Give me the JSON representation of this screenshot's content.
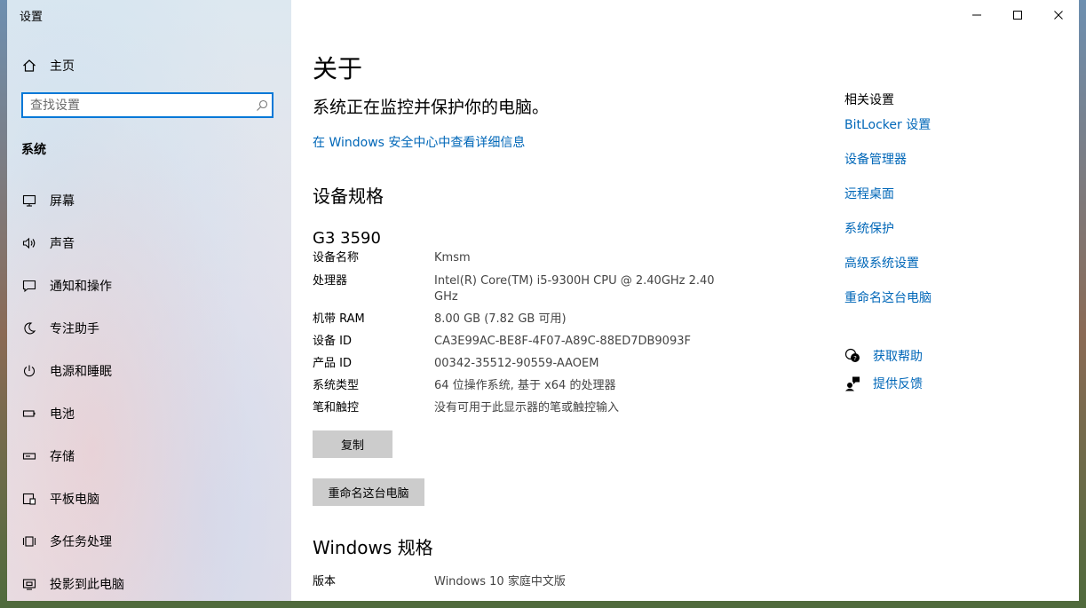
{
  "app_title": "设置",
  "sidebar": {
    "home_label": "主页",
    "search_placeholder": "查找设置",
    "section_title": "系统",
    "items": [
      {
        "label": "屏幕",
        "icon": "monitor-icon"
      },
      {
        "label": "声音",
        "icon": "speaker-icon"
      },
      {
        "label": "通知和操作",
        "icon": "notification-icon"
      },
      {
        "label": "专注助手",
        "icon": "moon-icon"
      },
      {
        "label": "电源和睡眠",
        "icon": "power-icon"
      },
      {
        "label": "电池",
        "icon": "battery-icon"
      },
      {
        "label": "存储",
        "icon": "storage-icon"
      },
      {
        "label": "平板电脑",
        "icon": "tablet-icon"
      },
      {
        "label": "多任务处理",
        "icon": "multitask-icon"
      },
      {
        "label": "投影到此电脑",
        "icon": "project-icon"
      }
    ]
  },
  "window_controls": {
    "minimize": "minimize-icon",
    "maximize": "maximize-icon",
    "close": "close-icon"
  },
  "main": {
    "title": "关于",
    "status_text": "系统正在监控并保护你的电脑。",
    "security_link": "在 Windows 安全中心中查看详细信息",
    "device_specs_title": "设备规格",
    "device_model": "G3 3590",
    "specs": [
      {
        "key": "设备名称",
        "value": "Kmsm"
      },
      {
        "key": "处理器",
        "value": "Intel(R) Core(TM) i5-9300H CPU @ 2.40GHz   2.40 GHz"
      },
      {
        "key": "机带 RAM",
        "value": "8.00 GB (7.82 GB 可用)"
      },
      {
        "key": "设备 ID",
        "value": "CA3E99AC-BE8F-4F07-A89C-88ED7DB9093F"
      },
      {
        "key": "产品 ID",
        "value": "00342-35512-90559-AAOEM"
      },
      {
        "key": "系统类型",
        "value": "64 位操作系统, 基于 x64 的处理器"
      },
      {
        "key": "笔和触控",
        "value": "没有可用于此显示器的笔或触控输入"
      }
    ],
    "copy_button": "复制",
    "rename_button": "重命名这台电脑",
    "windows_specs_title": "Windows 规格",
    "win_specs": [
      {
        "key": "版本",
        "value": "Windows 10 家庭中文版"
      }
    ]
  },
  "related": {
    "title": "相关设置",
    "links": [
      "BitLocker 设置",
      "设备管理器",
      "远程桌面",
      "系统保护",
      "高级系统设置",
      "重命名这台电脑"
    ],
    "help_label": "获取帮助",
    "feedback_label": "提供反馈"
  },
  "colors": {
    "accent": "#0078d7",
    "link": "#0067b8",
    "button_bg": "#cccccc"
  }
}
